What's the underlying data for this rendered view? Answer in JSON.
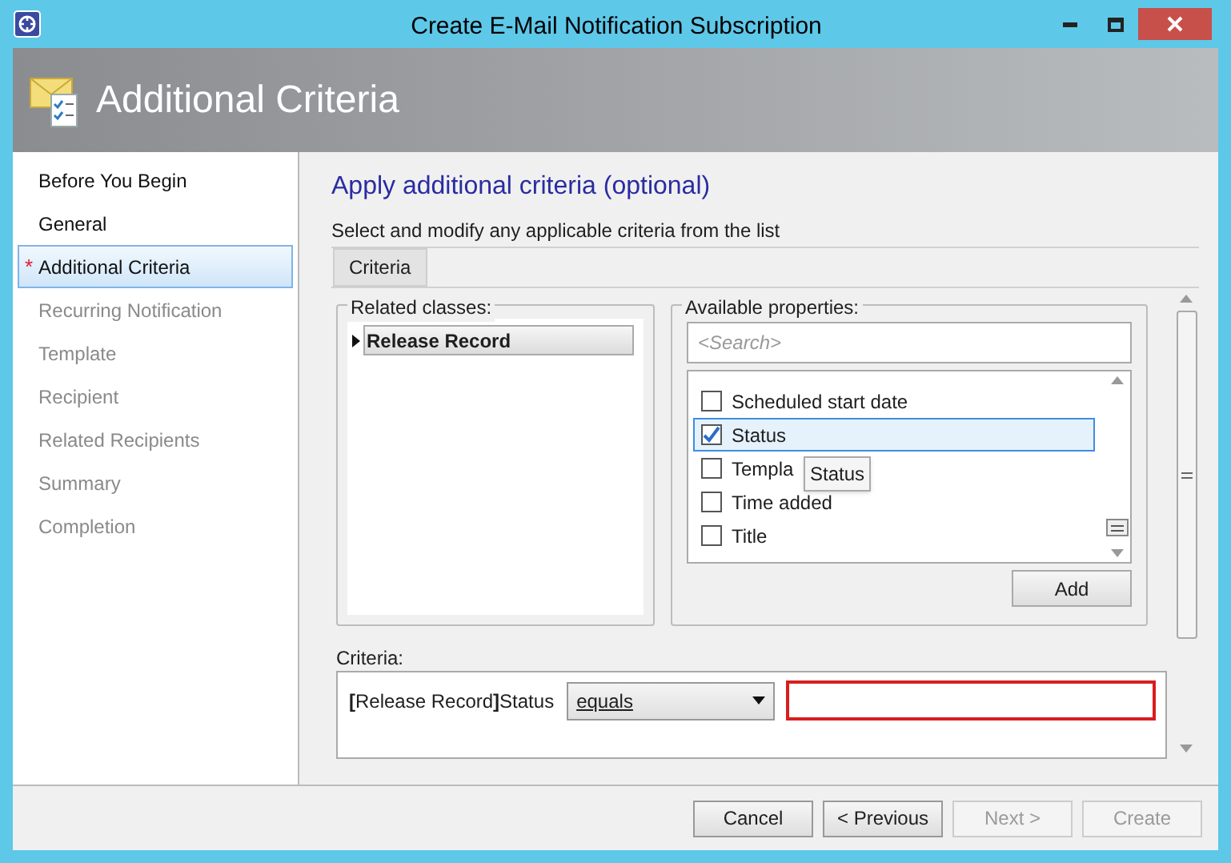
{
  "window": {
    "title": "Create E-Mail Notification Subscription"
  },
  "header": {
    "title": "Additional Criteria"
  },
  "sidebar": {
    "items": [
      {
        "label": "Before You Begin",
        "selected": false,
        "disabled": false
      },
      {
        "label": "General",
        "selected": false,
        "disabled": false
      },
      {
        "label": "Additional Criteria",
        "selected": true,
        "disabled": false,
        "marker": "*"
      },
      {
        "label": "Recurring Notification",
        "selected": false,
        "disabled": true
      },
      {
        "label": "Template",
        "selected": false,
        "disabled": true
      },
      {
        "label": "Recipient",
        "selected": false,
        "disabled": true
      },
      {
        "label": "Related Recipients",
        "selected": false,
        "disabled": true
      },
      {
        "label": "Summary",
        "selected": false,
        "disabled": true
      },
      {
        "label": "Completion",
        "selected": false,
        "disabled": true
      }
    ]
  },
  "page": {
    "title": "Apply additional criteria (optional)",
    "subtitle": "Select and modify any applicable criteria from the list"
  },
  "tabs": [
    {
      "label": "Criteria",
      "selected": true
    }
  ],
  "related_classes": {
    "label": "Related classes:",
    "items": [
      {
        "label": "Release Record",
        "selected": true,
        "expanded": false
      }
    ]
  },
  "available_properties": {
    "label": "Available properties:",
    "search": {
      "placeholder": "<Search>"
    },
    "items": [
      {
        "label": "Scheduled start date",
        "checked": false,
        "selected": false
      },
      {
        "label": "Status",
        "checked": true,
        "selected": true
      },
      {
        "label": "Templa",
        "checked": false,
        "selected": false
      },
      {
        "label": "Time added",
        "checked": false,
        "selected": false
      },
      {
        "label": "Title",
        "checked": false,
        "selected": false
      }
    ],
    "tooltip": "Status",
    "add_button": "Add"
  },
  "criteria": {
    "label": "Criteria:",
    "rows": [
      {
        "field": "**[**Release Record**]**Status",
        "operator": "equals",
        "value": "",
        "invalid": true
      }
    ]
  },
  "buttons": [
    {
      "label": "Cancel",
      "disabled": false
    },
    {
      "label": "< Previous",
      "disabled": false
    },
    {
      "label": "Next >",
      "disabled": true
    },
    {
      "label": "Create",
      "disabled": true
    }
  ]
}
